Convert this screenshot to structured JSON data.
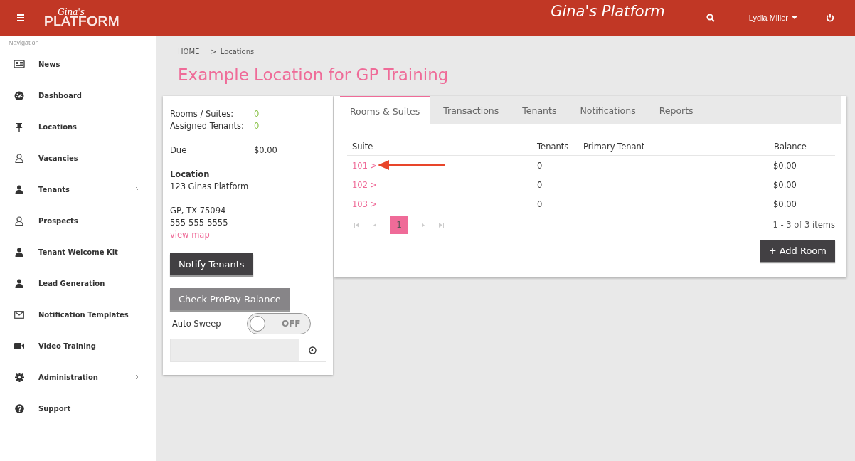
{
  "header": {
    "logo_script": "Gina's",
    "logo_text": "PLATFORM",
    "title": "Gina's Platform",
    "user": "Lydia Miller"
  },
  "sidebar": {
    "heading": "Navigation",
    "items": [
      {
        "label": "News",
        "expandable": false
      },
      {
        "label": "Dashboard",
        "expandable": false
      },
      {
        "label": "Locations",
        "expandable": false
      },
      {
        "label": "Vacancies",
        "expandable": false
      },
      {
        "label": "Tenants",
        "expandable": true
      },
      {
        "label": "Prospects",
        "expandable": false
      },
      {
        "label": "Tenant Welcome Kit",
        "expandable": false
      },
      {
        "label": "Lead Generation",
        "expandable": false
      },
      {
        "label": "Notification Templates",
        "expandable": false
      },
      {
        "label": "Video Training",
        "expandable": false
      },
      {
        "label": "Administration",
        "expandable": true
      },
      {
        "label": "Support",
        "expandable": false
      }
    ]
  },
  "breadcrumb": {
    "separator": ">",
    "items": [
      {
        "label": "HOME"
      },
      {
        "label": "Locations"
      }
    ]
  },
  "page_title": "Example Location for GP Training",
  "summary": {
    "stats": [
      {
        "label": "Rooms / Suites:",
        "value": "0"
      },
      {
        "label": "Assigned Tenants:",
        "value": "0"
      }
    ],
    "due": {
      "label": "Due",
      "value": "$0.00"
    },
    "location": {
      "heading": "Location",
      "street": "123 Ginas Platform",
      "lines": [
        "GP, TX 75094",
        "555-555-5555"
      ],
      "link": "view map"
    },
    "buttons": [
      {
        "label": "Notify Tenants",
        "kind": "primary"
      },
      {
        "label": "Check ProPay Balance",
        "kind": "secondary"
      }
    ],
    "auto_sweep": {
      "label": "Auto Sweep",
      "on": false,
      "state_text": "OFF"
    }
  },
  "tabs": [
    {
      "label": "Rooms & Suites",
      "selected": true
    },
    {
      "label": "Transactions",
      "selected": false
    },
    {
      "label": "Tenants",
      "selected": false
    },
    {
      "label": "Notifications",
      "selected": false
    },
    {
      "label": "Reports",
      "selected": false
    }
  ],
  "table": {
    "columns": [
      "Suite",
      "Tenants",
      "Primary Tenant",
      "Balance"
    ],
    "rows": [
      [
        "101 >",
        "0",
        "",
        "$0.00"
      ],
      [
        "102 >",
        "0",
        "",
        "$0.00"
      ],
      [
        "103 >",
        "0",
        "",
        "$0.00"
      ]
    ]
  },
  "pager": {
    "pages": [
      {
        "label": "1",
        "selected": true
      }
    ],
    "info": "1 - 3 of 3 items"
  },
  "add_button": "+ Add Room"
}
